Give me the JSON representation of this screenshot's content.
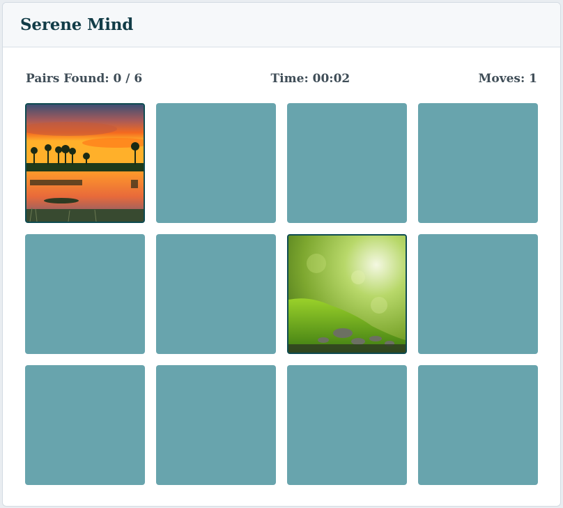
{
  "app": {
    "title": "Serene Mind"
  },
  "stats": {
    "pairs_label": "Pairs Found: 0 / 6",
    "time_label": "Time: 00:02",
    "moves_label": "Moves: 1"
  },
  "cards": [
    {
      "state": "face-up",
      "image": "sunset-lake-image"
    },
    {
      "state": "face-down"
    },
    {
      "state": "face-down"
    },
    {
      "state": "face-down"
    },
    {
      "state": "face-down"
    },
    {
      "state": "face-down"
    },
    {
      "state": "face-up",
      "image": "mossy-forest-image"
    },
    {
      "state": "face-down"
    },
    {
      "state": "face-down"
    },
    {
      "state": "face-down"
    },
    {
      "state": "face-down"
    },
    {
      "state": "face-down"
    }
  ],
  "colors": {
    "card_back": "#68a4ad",
    "card_border": "#0e4b51",
    "title": "#123c47"
  }
}
